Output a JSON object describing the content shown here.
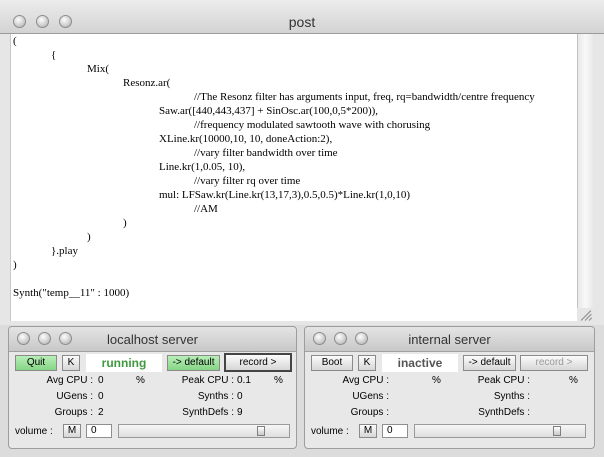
{
  "post": {
    "title": "post",
    "lines": [
      "(",
      "{",
      "Mix(",
      "Resonz.ar(",
      "//The Resonz filter has arguments input, freq, rq=bandwidth/centre frequency",
      "Saw.ar([440,443,437] + SinOsc.ar(100,0,5*200)),",
      "//frequency modulated sawtooth wave with chorusing",
      "XLine.kr(10000,10, 10, doneAction:2),",
      "//vary filter bandwidth over time",
      "Line.kr(1,0.05, 10),",
      "//vary filter rq over time",
      "mul: LFSaw.kr(Line.kr(13,17,3),0.5,0.5)*Line.kr(1,0,10)",
      "//AM",
      ")",
      ")",
      "}.play",
      ")",
      "Synth(\"temp__11\" : 1000)"
    ]
  },
  "localhost": {
    "title": "localhost server",
    "quit": "Quit",
    "k": "K",
    "status": "running",
    "status_color": "#3f9a3f",
    "default": "-> default",
    "record": "record >",
    "avg_cpu_label": "Avg CPU :",
    "avg_cpu": "0",
    "avg_unit": "%",
    "peak_cpu_label": "Peak CPU :",
    "peak_cpu": "0.1",
    "peak_unit": "%",
    "ugens_label": "UGens :",
    "ugens": "0",
    "synths_label": "Synths :",
    "synths": "0",
    "groups_label": "Groups :",
    "groups": "2",
    "synthdefs_label": "SynthDefs :",
    "synthdefs": "9",
    "volume_label": "volume :",
    "m": "M",
    "volume": "0",
    "volume_level": 0.85
  },
  "internal": {
    "title": "internal server",
    "boot": "Boot",
    "k": "K",
    "status": "inactive",
    "status_color": "#555555",
    "default": "-> default",
    "record": "record >",
    "avg_cpu_label": "Avg CPU :",
    "avg_unit": "%",
    "peak_cpu_label": "Peak CPU :",
    "peak_unit": "%",
    "ugens_label": "UGens :",
    "synths_label": "Synths :",
    "groups_label": "Groups :",
    "synthdefs_label": "SynthDefs :",
    "volume_label": "volume :",
    "m": "M",
    "volume": "0",
    "volume_level": 0.85
  }
}
